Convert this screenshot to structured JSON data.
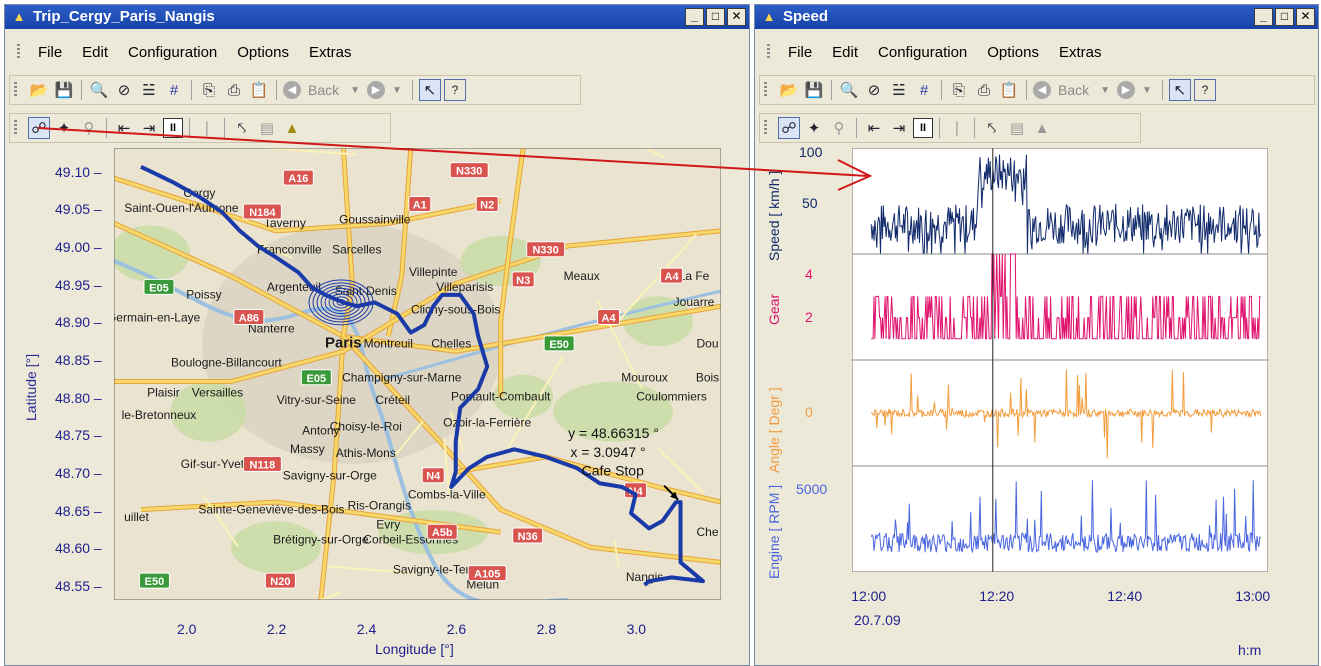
{
  "left_window": {
    "title": "Trip_Cergy_Paris_Nangis",
    "menu": [
      "File",
      "Edit",
      "Configuration",
      "Options",
      "Extras"
    ],
    "back_label": "Back",
    "map": {
      "ylabel": "Latitude [°]",
      "xlabel": "Longitude [°]",
      "yticks": [
        "49.10",
        "49.05",
        "49.00",
        "48.95",
        "48.90",
        "48.85",
        "48.80",
        "48.75",
        "48.70",
        "48.65",
        "48.60",
        "48.55"
      ],
      "xticks": [
        "2.0",
        "2.2",
        "2.4",
        "2.6",
        "2.8",
        "3.0"
      ],
      "cursor_y": "y = 48.66315 °",
      "cursor_x": "x = 3.0947 °",
      "cursor_note": "Cafe Stop",
      "places": [
        {
          "name": "Cergy",
          "lon": 2.03,
          "lat": 49.065
        },
        {
          "name": "Saint-Ouen-l'Aumone",
          "lon": 1.99,
          "lat": 49.045
        },
        {
          "name": "Taverny",
          "lon": 2.22,
          "lat": 49.025
        },
        {
          "name": "Goussainville",
          "lon": 2.42,
          "lat": 49.03
        },
        {
          "name": "Franconville",
          "lon": 2.23,
          "lat": 48.99
        },
        {
          "name": "Sarcelles",
          "lon": 2.38,
          "lat": 48.99
        },
        {
          "name": "Villepinte",
          "lon": 2.55,
          "lat": 48.96
        },
        {
          "name": "Argenteuil",
          "lon": 2.24,
          "lat": 48.94
        },
        {
          "name": "Saint-Denis",
          "lon": 2.4,
          "lat": 48.935
        },
        {
          "name": "Villeparisis",
          "lon": 2.62,
          "lat": 48.94
        },
        {
          "name": "Meaux",
          "lon": 2.88,
          "lat": 48.955
        },
        {
          "name": "La Fe",
          "lon": 3.13,
          "lat": 48.955
        },
        {
          "name": "Poissy",
          "lon": 2.04,
          "lat": 48.93
        },
        {
          "name": "Clichy-sous-Bois",
          "lon": 2.6,
          "lat": 48.91
        },
        {
          "name": "Jouarre",
          "lon": 3.13,
          "lat": 48.92
        },
        {
          "name": "t-Germain-en-Laye",
          "lon": 1.92,
          "lat": 48.9
        },
        {
          "name": "Nanterre",
          "lon": 2.19,
          "lat": 48.885
        },
        {
          "name": "Paris",
          "lon": 2.35,
          "lat": 48.865
        },
        {
          "name": "Montreuil",
          "lon": 2.45,
          "lat": 48.865
        },
        {
          "name": "Chelles",
          "lon": 2.59,
          "lat": 48.865
        },
        {
          "name": "Boulogne-Billancourt",
          "lon": 2.09,
          "lat": 48.84
        },
        {
          "name": "Champigny-sur-Marne",
          "lon": 2.48,
          "lat": 48.82
        },
        {
          "name": "Mouroux",
          "lon": 3.02,
          "lat": 48.82
        },
        {
          "name": "Plaisir",
          "lon": 1.95,
          "lat": 48.8
        },
        {
          "name": "Versailles",
          "lon": 2.07,
          "lat": 48.8
        },
        {
          "name": "Coulommiers",
          "lon": 3.08,
          "lat": 48.795
        },
        {
          "name": "Vitry-sur-Seine",
          "lon": 2.29,
          "lat": 48.79
        },
        {
          "name": "Créteil",
          "lon": 2.46,
          "lat": 48.79
        },
        {
          "name": "Pontault-Combault",
          "lon": 2.7,
          "lat": 48.795
        },
        {
          "name": "le-Bretonneux",
          "lon": 1.94,
          "lat": 48.77
        },
        {
          "name": "Antony",
          "lon": 2.3,
          "lat": 48.75
        },
        {
          "name": "Choisy-le-Roi",
          "lon": 2.4,
          "lat": 48.755
        },
        {
          "name": "Ozoir-la-Ferrière",
          "lon": 2.67,
          "lat": 48.76
        },
        {
          "name": "Massy",
          "lon": 2.27,
          "lat": 48.725
        },
        {
          "name": "Athis-Mons",
          "lon": 2.4,
          "lat": 48.72
        },
        {
          "name": "Gif-sur-Yvette",
          "lon": 2.07,
          "lat": 48.705
        },
        {
          "name": "Savigny-sur-Orge",
          "lon": 2.32,
          "lat": 48.69
        },
        {
          "name": "Combs-la-Ville",
          "lon": 2.58,
          "lat": 48.665
        },
        {
          "name": "uillet",
          "lon": 1.89,
          "lat": 48.635
        },
        {
          "name": "Sainte-Geneviève-des-Bois",
          "lon": 2.19,
          "lat": 48.645
        },
        {
          "name": "Ris-Orangis",
          "lon": 2.43,
          "lat": 48.65
        },
        {
          "name": "Evry",
          "lon": 2.45,
          "lat": 48.625
        },
        {
          "name": "Brétigny-sur-Orge",
          "lon": 2.3,
          "lat": 48.605
        },
        {
          "name": "Corbeil-Essonnes",
          "lon": 2.5,
          "lat": 48.605
        },
        {
          "name": "Savigny-le-Temple",
          "lon": 2.57,
          "lat": 48.565
        },
        {
          "name": "Melun",
          "lon": 2.66,
          "lat": 48.545
        },
        {
          "name": "Nangis",
          "lon": 3.02,
          "lat": 48.555
        },
        {
          "name": "Che",
          "lon": 3.16,
          "lat": 48.615
        },
        {
          "name": "Dou",
          "lon": 3.16,
          "lat": 48.865
        },
        {
          "name": "Bois",
          "lon": 3.16,
          "lat": 48.82
        }
      ],
      "road_badges": [
        {
          "label": "A16",
          "lon": 2.25,
          "lat": 49.09,
          "color": "#d9534f"
        },
        {
          "label": "N330",
          "lon": 2.63,
          "lat": 49.1,
          "color": "#d9534f"
        },
        {
          "label": "N184",
          "lon": 2.17,
          "lat": 49.045,
          "color": "#d9534f"
        },
        {
          "label": "A1",
          "lon": 2.52,
          "lat": 49.055,
          "color": "#d9534f"
        },
        {
          "label": "N2",
          "lon": 2.67,
          "lat": 49.055,
          "color": "#d9534f"
        },
        {
          "label": "N330",
          "lon": 2.8,
          "lat": 48.995,
          "color": "#d9534f"
        },
        {
          "label": "A4",
          "lon": 3.08,
          "lat": 48.96,
          "color": "#d9534f"
        },
        {
          "label": "E05",
          "lon": 1.94,
          "lat": 48.945,
          "color": "#3a9a3a"
        },
        {
          "label": "N3",
          "lon": 2.75,
          "lat": 48.955,
          "color": "#d9534f"
        },
        {
          "label": "A86",
          "lon": 2.14,
          "lat": 48.905,
          "color": "#d9534f"
        },
        {
          "label": "A4",
          "lon": 2.94,
          "lat": 48.905,
          "color": "#d9534f"
        },
        {
          "label": "E50",
          "lon": 2.83,
          "lat": 48.87,
          "color": "#3a9a3a"
        },
        {
          "label": "E05",
          "lon": 2.29,
          "lat": 48.825,
          "color": "#3a9a3a"
        },
        {
          "label": "N118",
          "lon": 2.17,
          "lat": 48.71,
          "color": "#d9534f"
        },
        {
          "label": "N4",
          "lon": 2.55,
          "lat": 48.695,
          "color": "#d9534f"
        },
        {
          "label": "N4",
          "lon": 3.0,
          "lat": 48.675,
          "color": "#d9534f"
        },
        {
          "label": "A5b",
          "lon": 2.57,
          "lat": 48.62,
          "color": "#d9534f"
        },
        {
          "label": "N36",
          "lon": 2.76,
          "lat": 48.615,
          "color": "#d9534f"
        },
        {
          "label": "E50",
          "lon": 1.93,
          "lat": 48.555,
          "color": "#3a9a3a"
        },
        {
          "label": "N20",
          "lon": 2.21,
          "lat": 48.555,
          "color": "#d9534f"
        },
        {
          "label": "A105",
          "lon": 2.67,
          "lat": 48.565,
          "color": "#d9534f"
        }
      ],
      "route": [
        [
          1.9,
          49.105
        ],
        [
          1.97,
          49.085
        ],
        [
          2.03,
          49.065
        ],
        [
          2.08,
          49.045
        ],
        [
          2.12,
          49.02
        ],
        [
          2.16,
          49.0
        ],
        [
          2.2,
          48.985
        ],
        [
          2.25,
          48.965
        ],
        [
          2.28,
          48.945
        ],
        [
          2.31,
          48.935
        ],
        [
          2.35,
          48.925
        ],
        [
          2.38,
          48.92
        ],
        [
          2.42,
          48.925
        ],
        [
          2.47,
          48.91
        ],
        [
          2.5,
          48.885
        ],
        [
          2.53,
          48.895
        ],
        [
          2.55,
          48.92
        ],
        [
          2.57,
          48.935
        ],
        [
          2.61,
          48.935
        ],
        [
          2.64,
          48.91
        ],
        [
          2.65,
          48.88
        ],
        [
          2.67,
          48.84
        ],
        [
          2.65,
          48.81
        ],
        [
          2.61,
          48.785
        ],
        [
          2.6,
          48.74
        ],
        [
          2.6,
          48.7
        ],
        [
          2.59,
          48.68
        ],
        [
          2.63,
          48.705
        ],
        [
          2.67,
          48.72
        ],
        [
          2.73,
          48.73
        ],
        [
          2.8,
          48.72
        ],
        [
          2.87,
          48.705
        ],
        [
          2.92,
          48.685
        ],
        [
          2.97,
          48.68
        ],
        [
          3.0,
          48.67
        ],
        [
          2.99,
          48.645
        ],
        [
          3.03,
          48.625
        ],
        [
          3.06,
          48.635
        ],
        [
          3.09,
          48.66
        ],
        [
          3.1,
          48.66
        ],
        [
          3.1,
          48.62
        ],
        [
          3.1,
          48.58
        ],
        [
          3.15,
          48.555
        ],
        [
          3.08,
          48.56
        ],
        [
          3.03,
          48.555
        ],
        [
          3.02,
          48.55
        ]
      ]
    }
  },
  "right_window": {
    "title": "Speed",
    "menu": [
      "File",
      "Edit",
      "Configuration",
      "Options",
      "Extras"
    ],
    "back_label": "Back",
    "unit_hm": "h:m",
    "date": "20.7.09"
  },
  "chart_data": {
    "type": "line",
    "x": [
      "12:00",
      "12:20",
      "12:40",
      "13:00"
    ],
    "x_range": [
      "11:57",
      "13:02"
    ],
    "xlabel": "h:m",
    "panels": [
      {
        "name": "Speed",
        "unit": "[ km/h ]",
        "ylim": [
          0,
          105
        ],
        "yticks": [
          50,
          100
        ],
        "color": "#102a6b"
      },
      {
        "name": "Gear",
        "unit": "",
        "ylim": [
          0,
          5
        ],
        "yticks": [
          2,
          4
        ],
        "color": "#e0136e"
      },
      {
        "name": "Angle",
        "unit": "[ Degr ]",
        "ylim": [
          -40,
          40
        ],
        "yticks": [
          0
        ],
        "color": "#f39c3c"
      },
      {
        "name": "Engine",
        "unit": "[ RPM ]",
        "ylim": [
          0,
          6500
        ],
        "yticks": [
          5000
        ],
        "color": "#4a66e0"
      }
    ],
    "cursor_time": "12:19"
  },
  "colors": {
    "route": "#1a3aa8",
    "arrow": "#d01818"
  }
}
